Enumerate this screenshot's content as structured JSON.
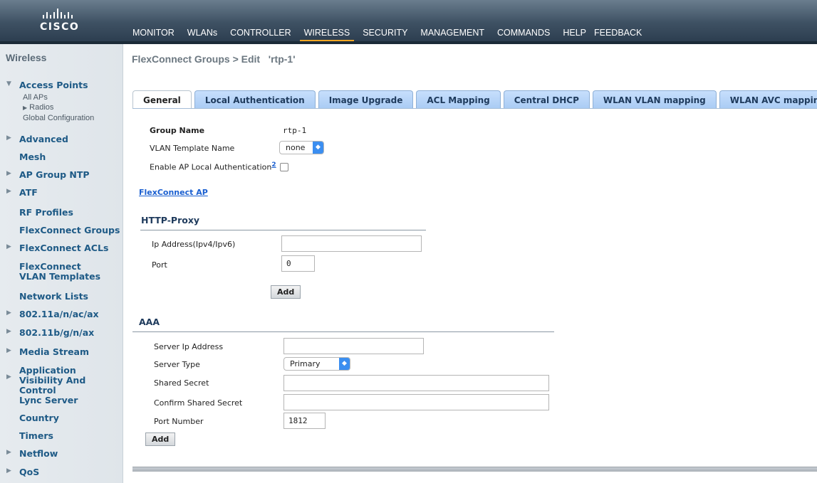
{
  "brand": {
    "logo_text": "CISCO"
  },
  "menu": {
    "items": [
      "MONITOR",
      "WLANs",
      "CONTROLLER",
      "WIRELESS",
      "SECURITY",
      "MANAGEMENT",
      "COMMANDS",
      "HELP",
      "FEEDBACK"
    ],
    "active": "WIRELESS"
  },
  "sidebar": {
    "title": "Wireless",
    "access_points": "Access Points",
    "ap_sub": [
      "All APs",
      "Radios",
      "Global Configuration"
    ],
    "items": [
      "Advanced",
      "Mesh",
      "AP Group NTP",
      "ATF",
      "RF Profiles",
      "FlexConnect Groups",
      "FlexConnect ACLs",
      "FlexConnect VLAN Templates",
      "Network Lists",
      "802.11a/n/ac/ax",
      "802.11b/g/n/ax",
      "Media Stream",
      "Application Visibility And Control",
      "Lync Server",
      "Country",
      "Timers",
      "Netflow",
      "QoS"
    ]
  },
  "page": {
    "title": "FlexConnect Groups > Edit   'rtp-1'"
  },
  "tabs": [
    "General",
    "Local Authentication",
    "Image Upgrade",
    "ACL Mapping",
    "Central DHCP",
    "WLAN VLAN mapping",
    "WLAN AVC mapping"
  ],
  "general": {
    "group_name_label": "Group Name",
    "group_name_value": "rtp-1",
    "vlan_template_label": "VLAN Template Name",
    "vlan_template_value": "none",
    "enable_ap_local_auth_label": "Enable AP Local Authentication",
    "footnote": "2",
    "enable_ap_local_auth_checked": false,
    "flexconnect_ap_link": "FlexConnect AP"
  },
  "http_proxy": {
    "title": "HTTP-Proxy",
    "ip_label": "Ip Address(Ipv4/Ipv6)",
    "ip_value": "",
    "port_label": "Port",
    "port_value": "0",
    "add_label": "Add"
  },
  "aaa": {
    "title": "AAA",
    "server_ip_label": "Server Ip Address",
    "server_ip_value": "",
    "server_type_label": "Server Type",
    "server_type_value": "Primary",
    "shared_secret_label": "Shared Secret",
    "shared_secret_value": "",
    "confirm_secret_label": "Confirm Shared Secret",
    "confirm_secret_value": "",
    "port_label": "Port Number",
    "port_value": "1812",
    "add_label": "Add"
  }
}
